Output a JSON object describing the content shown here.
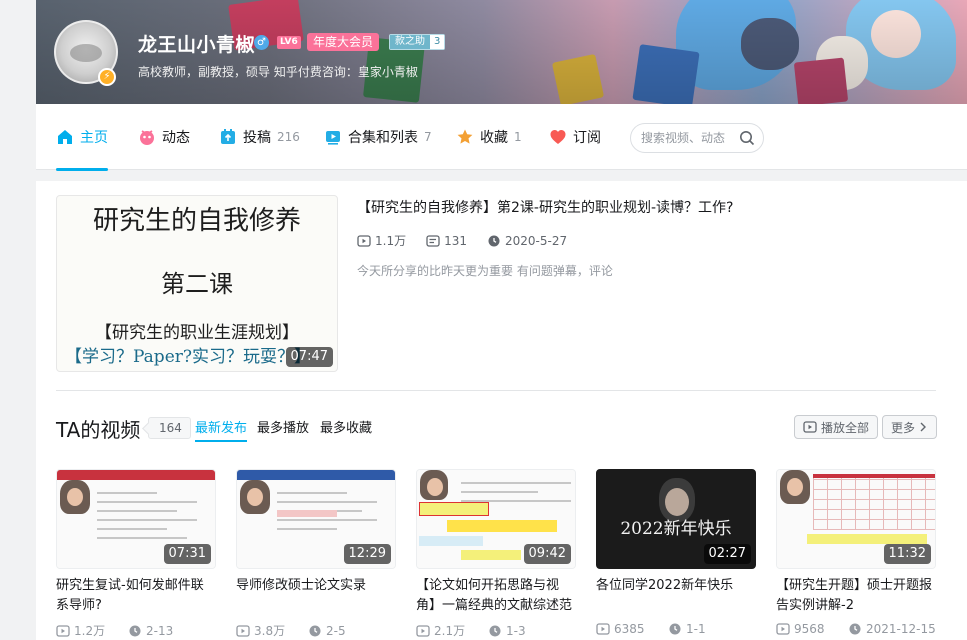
{
  "user": {
    "name": "龙王山小青椒",
    "sex_symbol": "♂",
    "level": "LV6",
    "vip": "年度大会员",
    "medal_name": "款之助",
    "medal_level": "3",
    "sign": "高校教师，副教授，硕导 知乎付费咨询：皇家小青椒"
  },
  "nav": {
    "items": [
      {
        "label": "主页",
        "count": "",
        "icon": "home-icon"
      },
      {
        "label": "动态",
        "count": "",
        "icon": "dynamic-icon"
      },
      {
        "label": "投稿",
        "count": "216",
        "icon": "upload-icon"
      },
      {
        "label": "合集和列表",
        "count": "7",
        "icon": "collection-icon"
      },
      {
        "label": "收藏",
        "count": "1",
        "icon": "star-icon"
      },
      {
        "label": "订阅",
        "count": "",
        "icon": "heart-icon"
      }
    ],
    "search_placeholder": "搜索视频、动态"
  },
  "featured": {
    "thumb_lines": [
      "研究生的自我修养",
      "第二课",
      "【研究生的职业生涯规划】",
      "【学习？Paper?实习？玩耍？】"
    ],
    "duration": "07:47",
    "title": "【研究生的自我修养】第2课-研究生的职业规划-读博？工作?",
    "views": "1.1万",
    "danmaku": "131",
    "date": "2020-5-27",
    "desc": "今天所分享的比昨天更为重要 有问题弹幕，评论"
  },
  "videos_section": {
    "title": "TA的视频",
    "count": "164",
    "sort_tabs": [
      "最新发布",
      "最多播放",
      "最多收藏"
    ],
    "play_all": "播放全部",
    "more": "更多"
  },
  "videos": [
    {
      "title": "研究生复试-如何发邮件联系导师?",
      "duration": "07:31",
      "views": "1.2万",
      "date": "2-13"
    },
    {
      "title": "导师修改硕士论文实录",
      "duration": "12:29",
      "views": "3.8万",
      "date": "2-5"
    },
    {
      "title": "【论文如何开拓思路与视角】一篇经典的文献综述范文",
      "duration": "09:42",
      "views": "2.1万",
      "date": "1-3"
    },
    {
      "title": "各位同学2022新年快乐",
      "duration": "02:27",
      "views": "6385",
      "date": "1-1",
      "thumb_text": "2022新年快乐"
    },
    {
      "title": "【研究生开题】硕士开题报告实例讲解-2",
      "duration": "11:32",
      "views": "9568",
      "date": "2021-12-15"
    }
  ],
  "colors": {
    "accent": "#00aeec",
    "pink": "#fb7299"
  }
}
